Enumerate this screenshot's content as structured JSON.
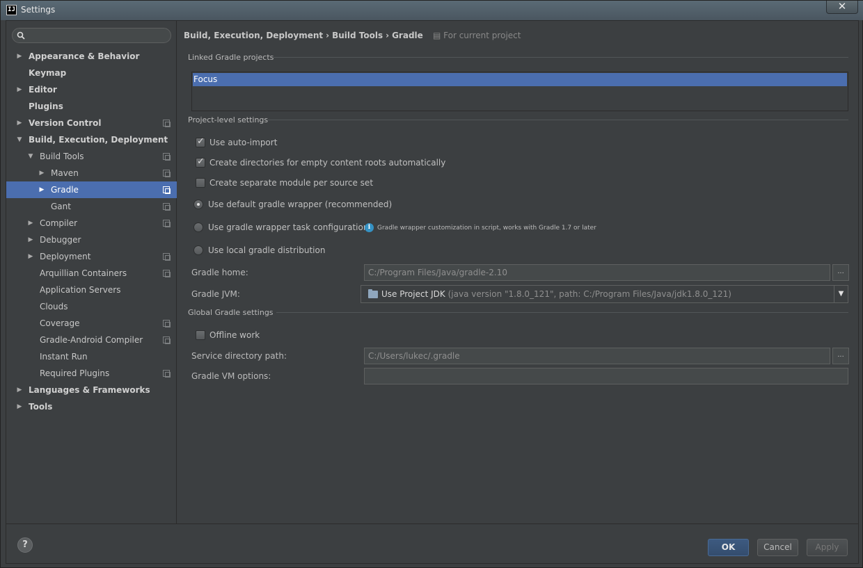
{
  "window": {
    "title": "Settings",
    "app_icon_text": "IJ",
    "close_glyph": "✕"
  },
  "search": {
    "placeholder": ""
  },
  "sidebar": {
    "items": [
      {
        "label": "Appearance & Behavior"
      },
      {
        "label": "Keymap"
      },
      {
        "label": "Editor"
      },
      {
        "label": "Plugins"
      },
      {
        "label": "Version Control"
      },
      {
        "label": "Build, Execution, Deployment"
      },
      {
        "label": "Build Tools"
      },
      {
        "label": "Maven"
      },
      {
        "label": "Gradle"
      },
      {
        "label": "Gant"
      },
      {
        "label": "Compiler"
      },
      {
        "label": "Debugger"
      },
      {
        "label": "Deployment"
      },
      {
        "label": "Arquillian Containers"
      },
      {
        "label": "Application Servers"
      },
      {
        "label": "Clouds"
      },
      {
        "label": "Coverage"
      },
      {
        "label": "Gradle-Android Compiler"
      },
      {
        "label": "Instant Run"
      },
      {
        "label": "Required Plugins"
      },
      {
        "label": "Languages & Frameworks"
      },
      {
        "label": "Tools"
      }
    ]
  },
  "breadcrumb": {
    "items": [
      "Build, Execution, Deployment",
      "Build Tools",
      "Gradle"
    ],
    "separator": "›",
    "scope": "For current project"
  },
  "linked": {
    "title": "Linked Gradle projects",
    "projects": [
      "Focus"
    ]
  },
  "project_level": {
    "title": "Project-level settings",
    "options": {
      "auto_import": {
        "label": "Use auto-import",
        "checked": true
      },
      "create_dirs": {
        "label": "Create directories for empty content roots automatically",
        "checked": true
      },
      "separate_module": {
        "label": "Create separate module per source set",
        "checked": false
      },
      "default_wrapper": {
        "label": "Use default gradle wrapper (recommended)",
        "selected": true
      },
      "wrapper_task": {
        "label": "Use gradle wrapper task configuration",
        "selected": false
      },
      "local_dist": {
        "label": "Use local gradle distribution",
        "selected": false
      }
    },
    "info_text": "Gradle wrapper customization in script, works with Gradle 1.7 or later",
    "gradle_home": {
      "label": "Gradle home:",
      "value": "C:/Program Files/Java/gradle-2.10"
    },
    "gradle_jvm": {
      "label": "Gradle JVM:",
      "value": "Use Project JDK",
      "detail": "(java version \"1.8.0_121\", path: C:/Program Files/Java/jdk1.8.0_121)"
    },
    "browse_glyph": "..."
  },
  "global": {
    "title": "Global Gradle settings",
    "offline": {
      "label": "Offline work",
      "checked": false
    },
    "service_dir": {
      "label": "Service directory path:",
      "value": "C:/Users/lukec/.gradle"
    },
    "vm_options": {
      "label": "Gradle VM options:",
      "value": ""
    }
  },
  "buttons": {
    "help": "?",
    "ok": "OK",
    "cancel": "Cancel",
    "apply": "Apply"
  },
  "colors": {
    "selection": "#4b6eaf",
    "background": "#3c3f41",
    "info": "#3592c4"
  }
}
